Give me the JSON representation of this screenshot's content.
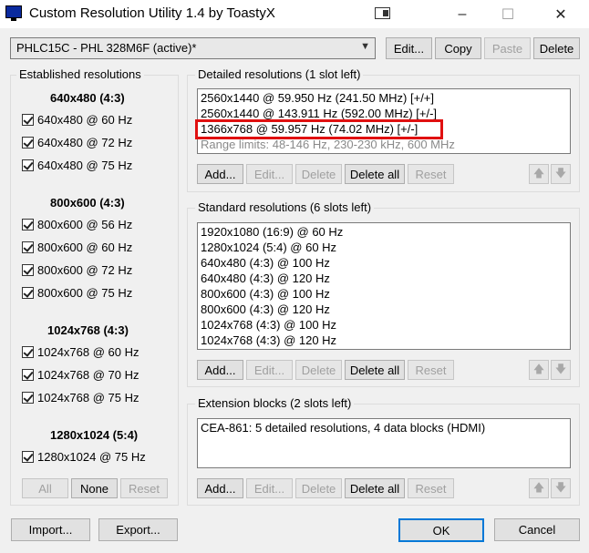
{
  "window": {
    "title": "Custom Resolution Utility 1.4 by ToastyX"
  },
  "titlebar": {
    "minimize": "–",
    "maximize": "☐",
    "close": "✕"
  },
  "monitor_select": {
    "selected": "PHLC15C - PHL 328M6F (active)*"
  },
  "top_buttons": {
    "edit": "Edit...",
    "copy": "Copy",
    "paste": "Paste",
    "delete": "Delete"
  },
  "established": {
    "title": "Established resolutions",
    "groups": [
      {
        "heading": "640x480 (4:3)",
        "items": [
          "640x480 @ 60 Hz",
          "640x480 @ 72 Hz",
          "640x480 @ 75 Hz"
        ]
      },
      {
        "heading": "800x600 (4:3)",
        "items": [
          "800x600 @ 56 Hz",
          "800x600 @ 60 Hz",
          "800x600 @ 72 Hz",
          "800x600 @ 75 Hz"
        ]
      },
      {
        "heading": "1024x768 (4:3)",
        "items": [
          "1024x768 @ 60 Hz",
          "1024x768 @ 70 Hz",
          "1024x768 @ 75 Hz"
        ]
      },
      {
        "heading": "1280x1024 (5:4)",
        "items": [
          "1280x1024 @ 75 Hz"
        ]
      }
    ],
    "buttons": {
      "all": "All",
      "none": "None",
      "reset": "Reset"
    }
  },
  "detailed": {
    "title": "Detailed resolutions (1 slot left)",
    "items": [
      "2560x1440 @ 59.950 Hz (241.50 MHz) [+/+]",
      "2560x1440 @ 143.911 Hz (592.00 MHz) [+/-]",
      "1366x768 @ 59.957 Hz (74.02 MHz) [+/-]"
    ],
    "range_limits": "Range limits: 48-146 Hz, 230-230 kHz, 600 MHz"
  },
  "standard": {
    "title": "Standard resolutions (6 slots left)",
    "items": [
      "1920x1080 (16:9) @ 60 Hz",
      "1280x1024 (5:4) @ 60 Hz",
      "640x480 (4:3) @ 100 Hz",
      "640x480 (4:3) @ 120 Hz",
      "800x600 (4:3) @ 100 Hz",
      "800x600 (4:3) @ 120 Hz",
      "1024x768 (4:3) @ 100 Hz",
      "1024x768 (4:3) @ 120 Hz"
    ]
  },
  "extension": {
    "title": "Extension blocks (2 slots left)",
    "items": [
      "CEA-861: 5 detailed resolutions, 4 data blocks (HDMI)"
    ]
  },
  "list_buttons": {
    "add": "Add...",
    "edit": "Edit...",
    "delete": "Delete",
    "delete_all": "Delete all",
    "reset": "Reset",
    "up": "🡅",
    "down": "🡇"
  },
  "footer": {
    "import": "Import...",
    "export": "Export...",
    "ok": "OK",
    "cancel": "Cancel"
  },
  "colors": {
    "highlight": "#e01010",
    "focus": "#0078d7"
  }
}
